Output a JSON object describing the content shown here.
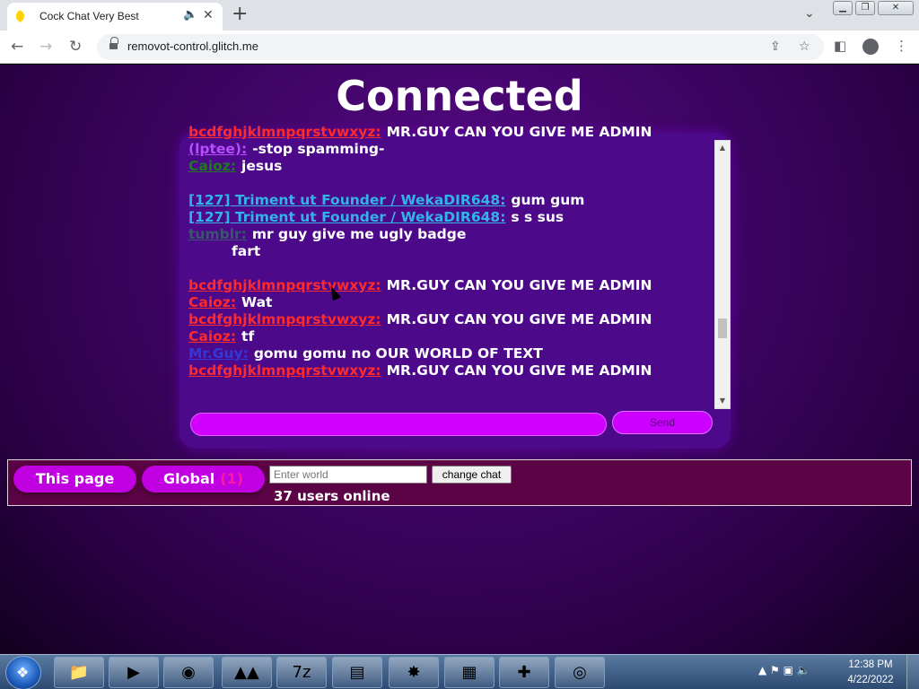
{
  "browser": {
    "tab_title": "Cock Chat Very Best",
    "tab_audio_icon": "speaker-icon",
    "new_tab_symbol": "+",
    "url": "removot-control.glitch.me"
  },
  "page": {
    "title": "Connected",
    "messages": [
      {
        "user": "bcdfghjklmnpqrstvwxyz:",
        "text": "MR.GUY CAN YOU GIVE ME ADMIN",
        "color": "#ff2a2a"
      },
      {
        "user": "(lptee):",
        "text": "-stop spamming-",
        "color": "#b84dff"
      },
      {
        "user": "Caioz:",
        "text": "jesus",
        "color": "#1e7a1e"
      },
      {
        "user": "",
        "text": "",
        "color": ""
      },
      {
        "user": "[127] Triment ut Founder / WekaDIR648:",
        "text": "gum gum",
        "color": "#33b4e8"
      },
      {
        "user": "[127] Triment ut Founder / WekaDIR648:",
        "text": "s s sus",
        "color": "#33b4e8"
      },
      {
        "user": "tumblr:",
        "text": "mr guy give me ugly badge",
        "color": "#3b5570"
      },
      {
        "user": "",
        "text": "fart",
        "color": "#4c0a8a"
      },
      {
        "user": "",
        "text": "",
        "color": ""
      },
      {
        "user": "bcdfghjklmnpqrstvwxyz:",
        "text": "MR.GUY CAN YOU GIVE ME ADMIN",
        "color": "#ff2a2a"
      },
      {
        "user": "Caioz:",
        "text": "Wat",
        "color": "#ff2a2a"
      },
      {
        "user": "bcdfghjklmnpqrstvwxyz:",
        "text": "MR.GUY CAN YOU GIVE ME ADMIN",
        "color": "#ff2a2a"
      },
      {
        "user": "Caioz:",
        "text": "tf",
        "color": "#ff2a2a"
      },
      {
        "user": "Mr.Guy:",
        "text": "gomu gomu no OUR WORLD OF TEXT",
        "color": "#2f3ad8"
      },
      {
        "user": "bcdfghjklmnpqrstvwxyz:",
        "text": "MR.GUY CAN YOU GIVE ME ADMIN",
        "color": "#ff2a2a"
      }
    ],
    "send_label": "Send",
    "this_page_label": "This page",
    "global_label": "Global",
    "global_count": "(1)",
    "world_placeholder": "Enter world",
    "change_chat_label": "change chat",
    "users_online": "37 users online"
  },
  "taskbar": {
    "items": [
      "explorer-icon",
      "media-player-icon",
      "chrome-icon",
      "app-triangles-icon",
      "7zip-icon",
      "filezilla-icon",
      "game-icon",
      "archive-icon",
      "joystick-icon",
      "media-center-icon"
    ],
    "time": "12:38 PM",
    "date": "4/22/2022"
  }
}
